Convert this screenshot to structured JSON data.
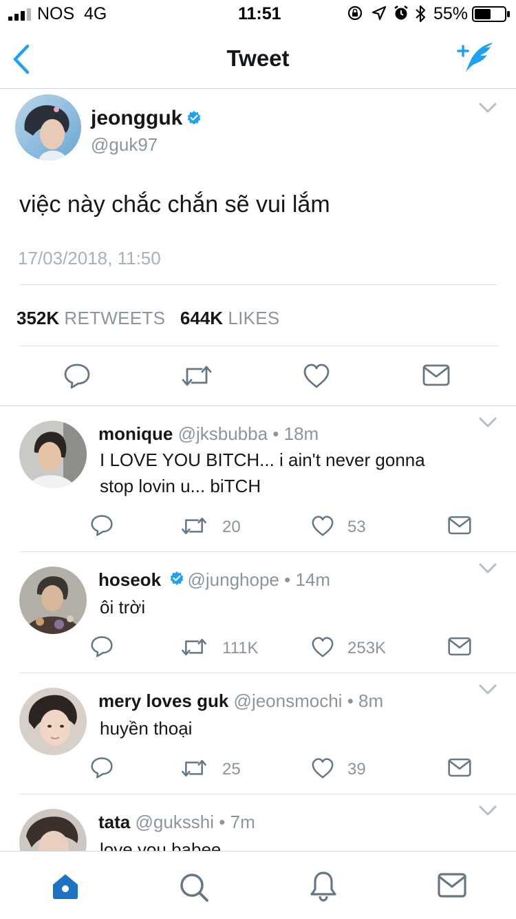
{
  "status_bar": {
    "carrier": "NOS",
    "network": "4G",
    "time": "11:51",
    "battery_percent": "55%",
    "battery_level": 0.55
  },
  "nav": {
    "title": "Tweet",
    "back_icon": "chevron-left-icon",
    "compose_icon": "compose-feather-icon"
  },
  "colors": {
    "accent": "#1da1f2",
    "secondary_text": "#8a959e",
    "divider": "#dbe1e6"
  },
  "main_tweet": {
    "name": "jeongguk",
    "handle": "@guk97",
    "text": "việc này chắc chắn sẽ vui lắm",
    "timestamp": "17/03/2018, 11:50",
    "retweets_count": "352K",
    "retweets_label": "RETWEETS",
    "likes_count": "644K",
    "likes_label": "LIKES"
  },
  "replies": [
    {
      "name": "monique",
      "handle": "@jksbubba",
      "time": "18m",
      "verified": false,
      "text_line1": "I LOVE YOU BITCH... i ain't never gonna",
      "text_line2": "stop lovin u... biTCH",
      "retweets": "20",
      "likes": "53"
    },
    {
      "name": "hoseok",
      "handle": "@junghope",
      "time": "14m",
      "verified": true,
      "text_line1": "ôi trời",
      "retweets": "111K",
      "likes": "253K"
    },
    {
      "name": "mery loves guk",
      "handle": "@jeonsmochi",
      "time": "8m",
      "verified": false,
      "text_line1": "huyền thoại",
      "retweets": "25",
      "likes": "39"
    },
    {
      "name": "tata",
      "handle": "@guksshi",
      "time": "7m",
      "verified": false,
      "text_line1": "love you babee"
    }
  ],
  "separator": "•",
  "tabbar": {
    "items": [
      "home-icon",
      "search-icon",
      "notifications-bell-icon",
      "messages-envelope-icon"
    ],
    "active": "home-icon"
  }
}
